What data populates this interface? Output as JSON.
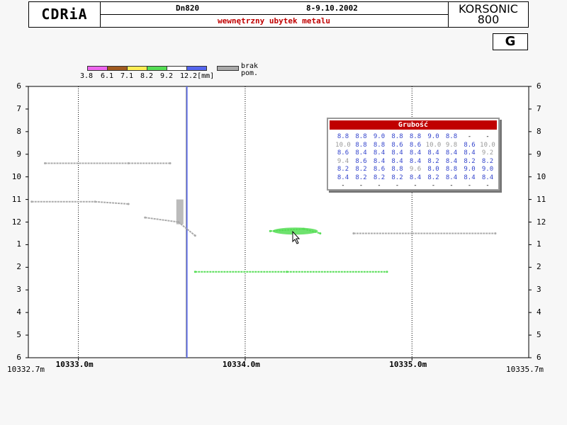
{
  "header": {
    "logo": "CDRiA",
    "pipe": "Dn820",
    "date": "8-9.10.2002",
    "subtitle": "wewnętrzny ubytek metalu",
    "device_line1": "KORSONIC",
    "device_line2": "800"
  },
  "mode_badge": "G",
  "legend": {
    "labels": [
      "3.8",
      "6.1",
      "7.1",
      "8.2",
      "9.2",
      "12.2[mm]"
    ],
    "colors": [
      "#ee66ee",
      "#a05a20",
      "#ffee55",
      "#55dd55",
      "#ffffff",
      "#5566ee"
    ],
    "missing_color": "#aaaaaa",
    "missing_label_1": "brak",
    "missing_label_2": "pom."
  },
  "table": {
    "title": "Grubość",
    "rows": [
      [
        "8.8",
        "8.8",
        "9.0",
        "8.8",
        "8.8",
        "9.0",
        "8.8",
        "-",
        "-"
      ],
      [
        "10.0",
        "8.8",
        "8.8",
        "8.6",
        "8.6",
        "10.0",
        "9.8",
        "8.6",
        "10.0"
      ],
      [
        "8.6",
        "8.4",
        "8.4",
        "8.4",
        "8.4",
        "8.4",
        "8.4",
        "8.4",
        "9.2"
      ],
      [
        "9.4",
        "8.6",
        "8.4",
        "8.4",
        "8.4",
        "8.2",
        "8.4",
        "8.2",
        "8.2"
      ],
      [
        "8.2",
        "8.2",
        "8.6",
        "8.8",
        "9.6",
        "8.0",
        "8.8",
        "9.0",
        "9.0"
      ],
      [
        "8.4",
        "8.2",
        "8.2",
        "8.2",
        "8.4",
        "8.2",
        "8.4",
        "8.4",
        "8.4"
      ],
      [
        "-",
        "-",
        "-",
        "-",
        "-",
        "-",
        "-",
        "-",
        "-"
      ]
    ]
  },
  "chart_data": {
    "type": "scatter",
    "x_edge_left": "10332.7m",
    "x_edge_right": "10335.7m",
    "xlim": [
      10332.7,
      10335.7
    ],
    "x_tick_values": [
      10333.0,
      10334.0,
      10335.0
    ],
    "x_tick_labels": [
      "10333.0m",
      "10334.0m",
      "10335.0m"
    ],
    "y_tick_labels": [
      "6",
      "7",
      "8",
      "9",
      "10",
      "11",
      "12",
      "1",
      "2",
      "3",
      "4",
      "5",
      "6"
    ],
    "grid": "dotted vertical at x ticks",
    "series": [
      {
        "color": "#5566ee",
        "x": [
          10333.65,
          10333.65
        ],
        "y": [
          6.0,
          6.0
        ]
      },
      {
        "color": "#55dd55",
        "x": [
          10333.7,
          10334.25,
          10334.85
        ],
        "y": [
          2.2,
          2.2,
          2.2
        ]
      },
      {
        "color": "#55dd55",
        "x": [
          10334.15,
          10334.35,
          10334.45
        ],
        "y": [
          12.4,
          12.3,
          12.5
        ]
      },
      {
        "color": "#aaaaaa",
        "x": [
          10332.8,
          10333.3,
          10333.55
        ],
        "y": [
          9.4,
          9.4,
          9.4
        ]
      },
      {
        "color": "#aaaaaa",
        "x": [
          10332.72,
          10333.1,
          10333.3
        ],
        "y": [
          11.1,
          11.1,
          11.2
        ]
      },
      {
        "color": "#aaaaaa",
        "x": [
          10333.4,
          10333.6,
          10333.7
        ],
        "y": [
          11.8,
          12.0,
          12.6
        ]
      },
      {
        "color": "#aaaaaa",
        "x": [
          10334.65,
          10335.0,
          10335.5
        ],
        "y": [
          12.5,
          12.5,
          12.5
        ]
      }
    ]
  }
}
